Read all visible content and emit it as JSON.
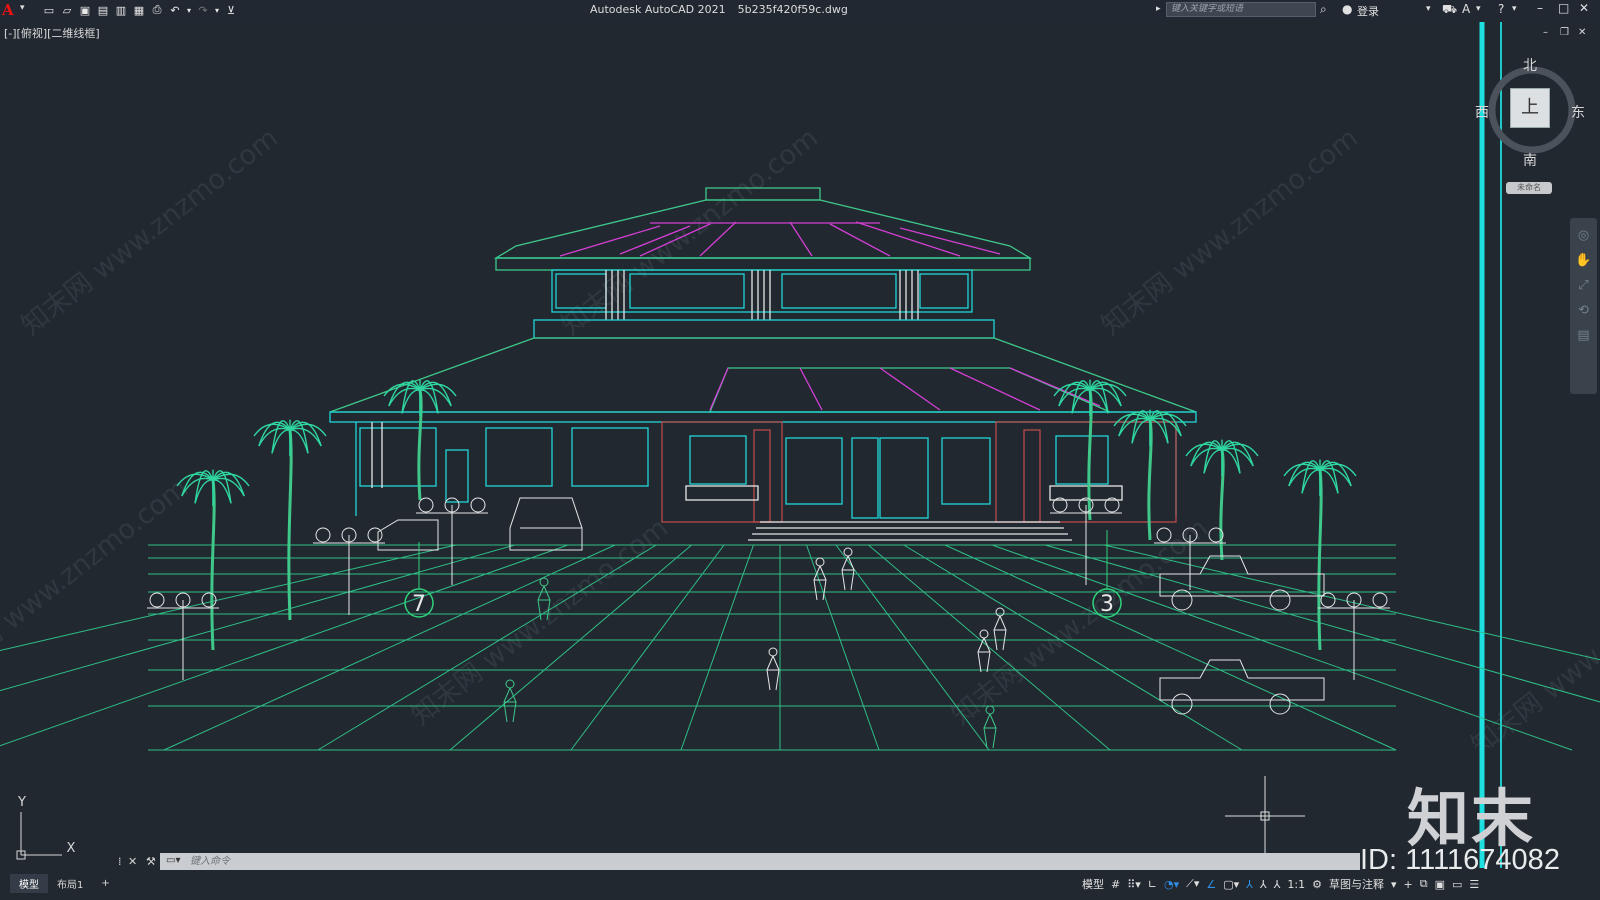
{
  "app": {
    "logo": "A",
    "name": "Autodesk AutoCAD 2021",
    "file": "5b235f420f59c.dwg"
  },
  "title_search": {
    "placeholder": "键入关键字或短语"
  },
  "login": {
    "label": "登录"
  },
  "quick_access": {
    "icons": [
      "new-icon",
      "open-icon",
      "save-icon",
      "save-as-icon",
      "plot-preview-icon",
      "publish-icon",
      "print-icon",
      "undo-icon",
      "redo-icon",
      "customize-icon"
    ]
  },
  "viewport": {
    "label": "[-][俯视][二维线框]"
  },
  "viewcube": {
    "north": "北",
    "south": "南",
    "east": "东",
    "west": "西",
    "face": "上",
    "wcs": "未命名"
  },
  "command": {
    "placeholder": "键入命令"
  },
  "layout_tabs": {
    "model": "模型",
    "layout1": "布局1",
    "add": "+"
  },
  "status": {
    "model": "模型",
    "scale": "1:1",
    "workspace": "草图与注释"
  },
  "ucs": {
    "x": "X",
    "y": "Y"
  },
  "drawing": {
    "markers": [
      "7",
      "3"
    ]
  },
  "watermark": {
    "text": "知末网 www.znzmo.com",
    "brand": "知末",
    "id": "ID: 1111674082"
  },
  "colors": {
    "background": "#212830",
    "cyan": "#1fd6d6",
    "magenta": "#d43fd4",
    "green": "#3fc88a",
    "white": "#e8e8e8",
    "red": "#b84b4b"
  }
}
